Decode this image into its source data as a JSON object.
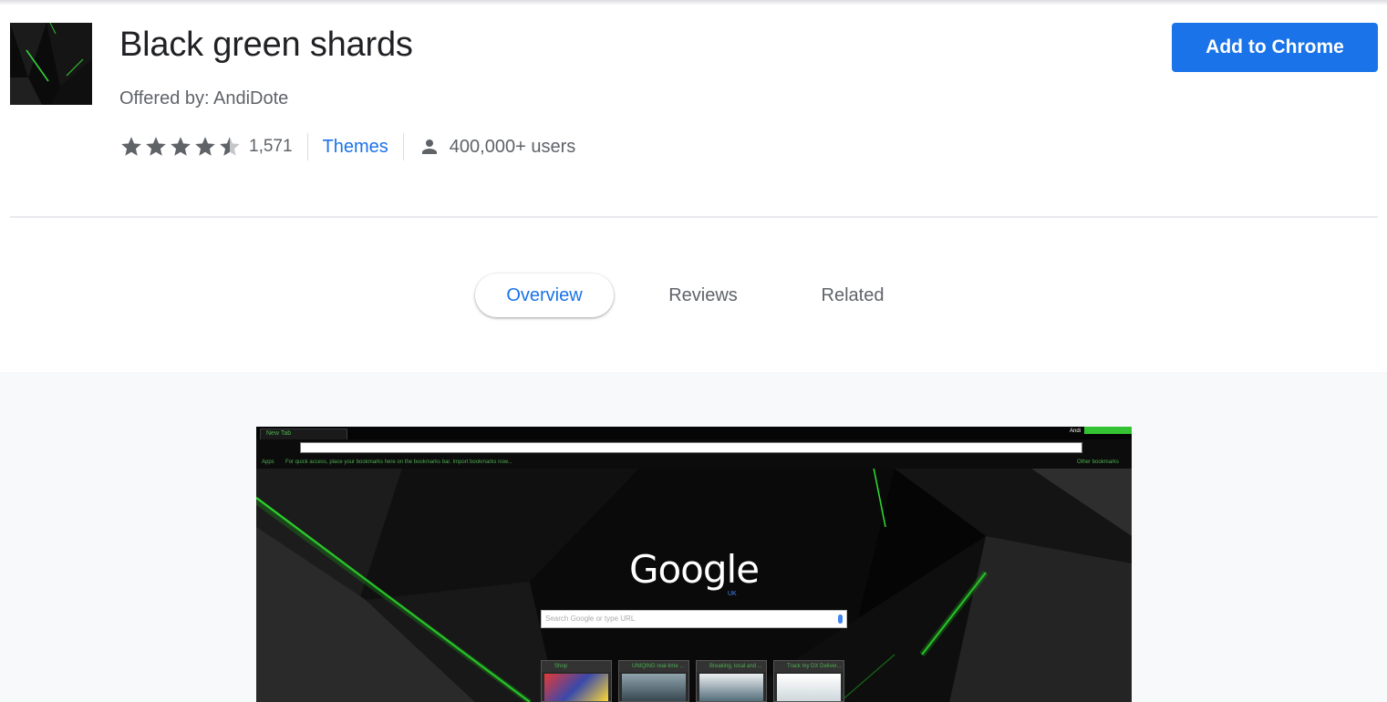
{
  "extension": {
    "title": "Black green shards",
    "offered_by": "Offered by: AndiDote",
    "rating": 4.5,
    "rating_count": "1,571",
    "category": "Themes",
    "users": "400,000+ users",
    "add_button": "Add to Chrome"
  },
  "tabs": [
    {
      "label": "Overview",
      "active": true
    },
    {
      "label": "Reviews",
      "active": false
    },
    {
      "label": "Related",
      "active": false
    }
  ],
  "screenshot": {
    "browser_tab_title": "New Tab",
    "user_name": "Andi",
    "bookmarks_apps": "Apps",
    "bookmarks_hint": "For quick access, place your bookmarks here on the bookmarks bar. Import bookmarks now...",
    "bookmarks_other": "Other bookmarks",
    "logo_text": "Google",
    "logo_region": "UK",
    "search_placeholder": "Search Google or type URL",
    "tiles": [
      {
        "title": "Shop",
        "icon_color": "#d32f2f"
      },
      {
        "title": "UNIQING real-time ...",
        "icon_color": "#1565c0"
      },
      {
        "title": "Breaking, local and ...",
        "icon_color": "#1e88e5"
      },
      {
        "title": "Track my DX Deliver...",
        "icon_color": "#1976d2"
      }
    ]
  },
  "colors": {
    "accent": "#1a73e8",
    "star": "#5f6368",
    "theme_green": "#32c232"
  },
  "icons": {
    "star": "star-icon",
    "half_star": "half-star-icon",
    "users": "person-icon"
  }
}
